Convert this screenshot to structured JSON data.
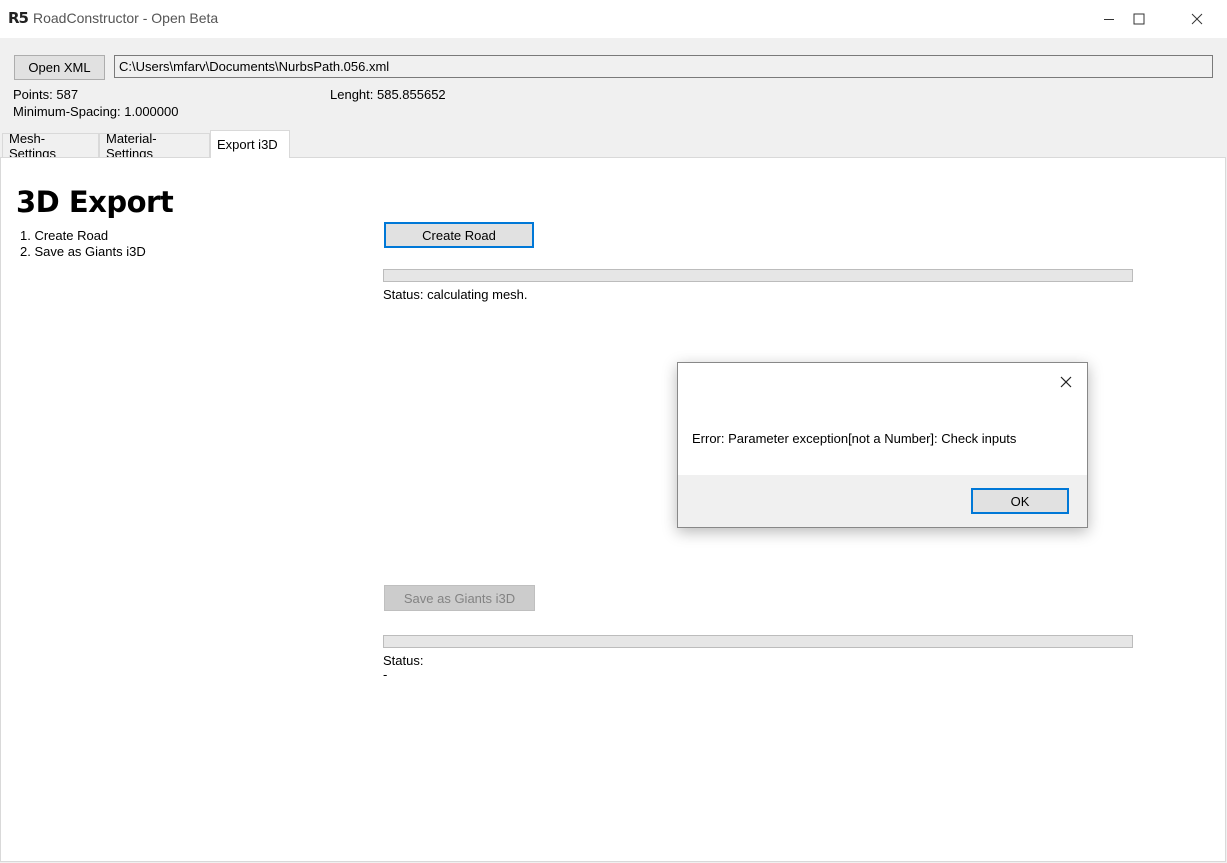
{
  "window": {
    "logo": "R5",
    "title": "RoadConstructor - Open Beta"
  },
  "toolbar": {
    "open_xml_label": "Open XML",
    "file_path": "C:\\Users\\mfarv\\Documents\\NurbsPath.056.xml"
  },
  "info": {
    "points": "Points: 587",
    "min_spacing": "Minimum-Spacing: 1.000000",
    "length": "Lenght: 585.855652"
  },
  "tabs": [
    {
      "label": "Mesh-Settings",
      "active": false
    },
    {
      "label": "Material-Settings",
      "active": false
    },
    {
      "label": "Export i3D",
      "active": true
    }
  ],
  "export": {
    "heading": "3D Export",
    "step1": "1. Create Road",
    "step2": "2. Save as Giants i3D",
    "create_road_label": "Create Road",
    "create_progress": 0,
    "create_status": "Status: calculating mesh.",
    "save_label": "Save as Giants i3D",
    "save_progress": 0,
    "save_status": "Status:",
    "save_status_detail": "-"
  },
  "dialog": {
    "message": "Error: Parameter exception[not a Number]: Check inputs",
    "ok_label": "OK"
  },
  "icons": {
    "minimize": "minimize-icon",
    "maximize": "maximize-icon",
    "close": "close-icon"
  },
  "colors": {
    "focus_border": "#0078d7",
    "chrome_bg": "#f0f0f0"
  }
}
